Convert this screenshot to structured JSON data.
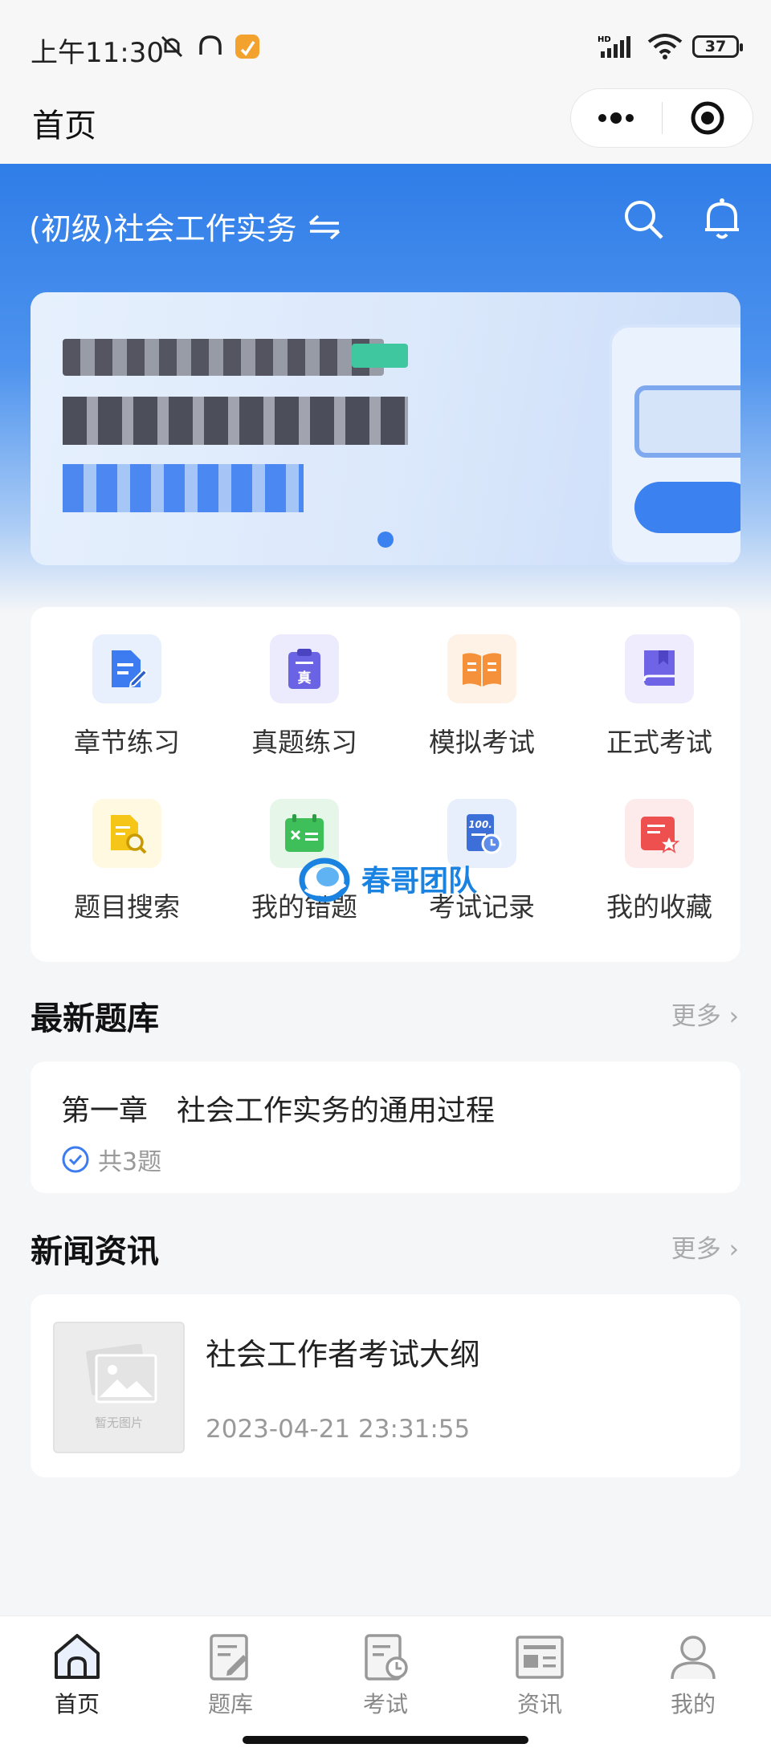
{
  "status_bar": {
    "time": "上午11:30",
    "battery": "37"
  },
  "nav": {
    "title": "首页"
  },
  "header": {
    "course": "(初级)社会工作实务",
    "switch_icon": "switch-arrows-icon"
  },
  "functions": [
    {
      "label": "章节练习",
      "icon": "chapter-practice-icon",
      "color": "#3d7cf0",
      "bg": "#e8f0fe"
    },
    {
      "label": "真题练习",
      "icon": "past-exam-icon",
      "color": "#6a63e4",
      "bg": "#ecebfd"
    },
    {
      "label": "模拟考试",
      "icon": "mock-exam-icon",
      "color": "#f4913a",
      "bg": "#fef1e5"
    },
    {
      "label": "正式考试",
      "icon": "formal-exam-icon",
      "color": "#7064e6",
      "bg": "#eeecfd"
    },
    {
      "label": "题目搜索",
      "icon": "question-search-icon",
      "color": "#f5c518",
      "bg": "#fef9e0"
    },
    {
      "label": "我的错题",
      "icon": "wrong-questions-icon",
      "color": "#3fbf5a",
      "bg": "#e6f7ea"
    },
    {
      "label": "考试记录",
      "icon": "exam-record-icon",
      "color": "#3d6fd8",
      "bg": "#e8effc"
    },
    {
      "label": "我的收藏",
      "icon": "favorites-icon",
      "color": "#ee4f4f",
      "bg": "#fdeaea"
    }
  ],
  "latest_bank": {
    "heading": "最新题库",
    "more": "更多",
    "item_title": "第一章　社会工作实务的通用过程",
    "item_count": "共3题"
  },
  "news": {
    "heading": "新闻资讯",
    "more": "更多",
    "thumb_placeholder": "暂无图片",
    "item_title": "社会工作者考试大纲",
    "item_date": "2023-04-21 23:31:55"
  },
  "watermark": "春哥团队",
  "tabs": [
    {
      "label": "首页",
      "icon": "home-icon",
      "active": true
    },
    {
      "label": "题库",
      "icon": "question-bank-icon",
      "active": false
    },
    {
      "label": "考试",
      "icon": "exam-icon",
      "active": false
    },
    {
      "label": "资讯",
      "icon": "news-icon",
      "active": false
    },
    {
      "label": "我的",
      "icon": "profile-icon",
      "active": false
    }
  ]
}
